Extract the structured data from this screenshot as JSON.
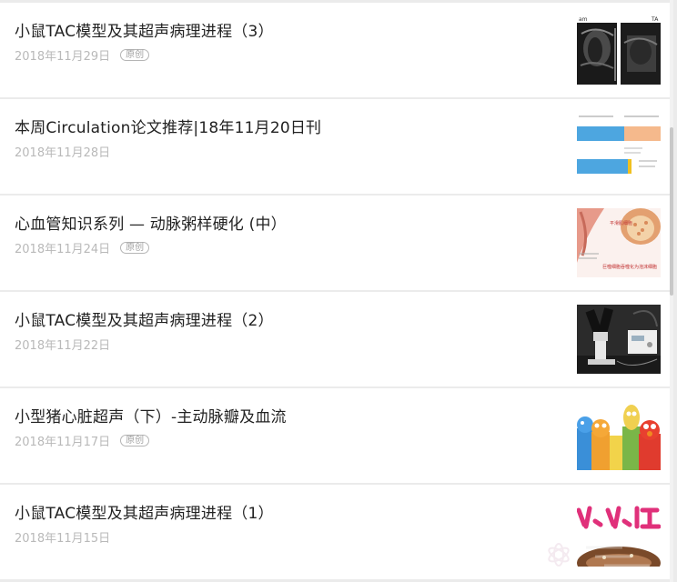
{
  "articles": [
    {
      "title": "小鼠TAC模型及其超声病理进程（3）",
      "date": "2018年11月29日",
      "tag": "原创",
      "thumbnail": "ultrasound-scan-image"
    },
    {
      "title": "本周Circulation论文推荐|18年11月20日刊",
      "date": "2018年11月28日",
      "tag": "",
      "thumbnail": "guideline-comparison-chart-image"
    },
    {
      "title": "心血管知识系列 — 动脉粥样硬化 (中）",
      "date": "2018年11月24日",
      "tag": "原创",
      "thumbnail": "artery-plaque-illustration-image"
    },
    {
      "title": "小鼠TAC模型及其超声病理进程（2）",
      "date": "2018年11月22日",
      "tag": "",
      "thumbnail": "microscope-equipment-photo"
    },
    {
      "title": "小型猪心脏超声（下）-主动脉瓣及血流",
      "date": "2018年11月17日",
      "tag": "原创",
      "thumbnail": "cartoon-characters-image"
    },
    {
      "title": "小鼠TAC模型及其超声病理进程（1）",
      "date": "2018年11月15日",
      "tag": "",
      "thumbnail": "pink-lettering-donut-image"
    }
  ],
  "thumb_labels": {
    "t1_left": "am",
    "t1_right": "TA",
    "t3_upper": "平滑肌细胞",
    "t3_lower": "巨噬细胞吞噬化为泡沫细胞"
  },
  "colors": {
    "page_background": "#ebebeb",
    "card_background": "#ffffff",
    "title_text": "#222222",
    "date_text": "#b9b9b9",
    "tag_border": "#b5b5b5"
  }
}
